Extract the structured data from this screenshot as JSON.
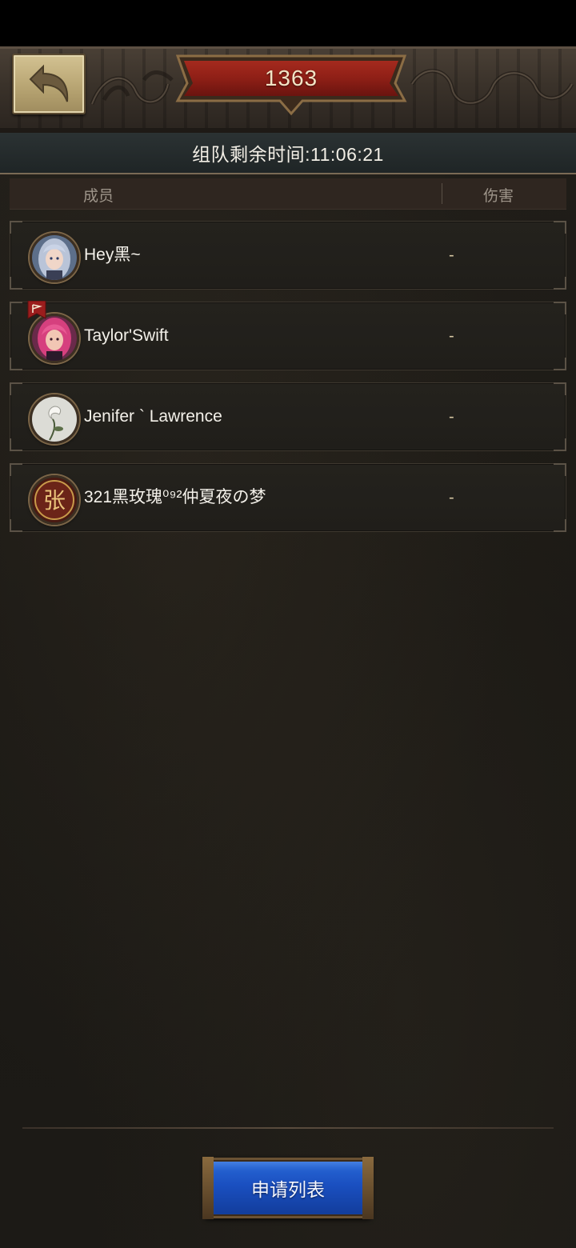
{
  "header": {
    "banner_value": "1363",
    "timer": "组队剩余时间:11:06:21"
  },
  "table": {
    "col_member": "成员",
    "col_damage": "伤害"
  },
  "members": [
    {
      "name": "Hey黑~",
      "damage": "-",
      "leader": false,
      "avatar": "blue-hair-girl"
    },
    {
      "name": "Taylor'Swift",
      "damage": "-",
      "leader": true,
      "avatar": "pink-hair-girl"
    },
    {
      "name": "Jenifer ` Lawrence",
      "damage": "-",
      "leader": false,
      "avatar": "white-rose"
    },
    {
      "name": "321黑玫瑰⁰⁹²仲夏夜の梦",
      "damage": "-",
      "leader": false,
      "avatar": "zhang-seal",
      "avatar_char": "张"
    }
  ],
  "footer": {
    "apply_list_label": "申请列表"
  },
  "colors": {
    "banner_red": "#8e1f16",
    "button_blue": "#1a4fc0",
    "gold_trim": "#7b6547"
  }
}
